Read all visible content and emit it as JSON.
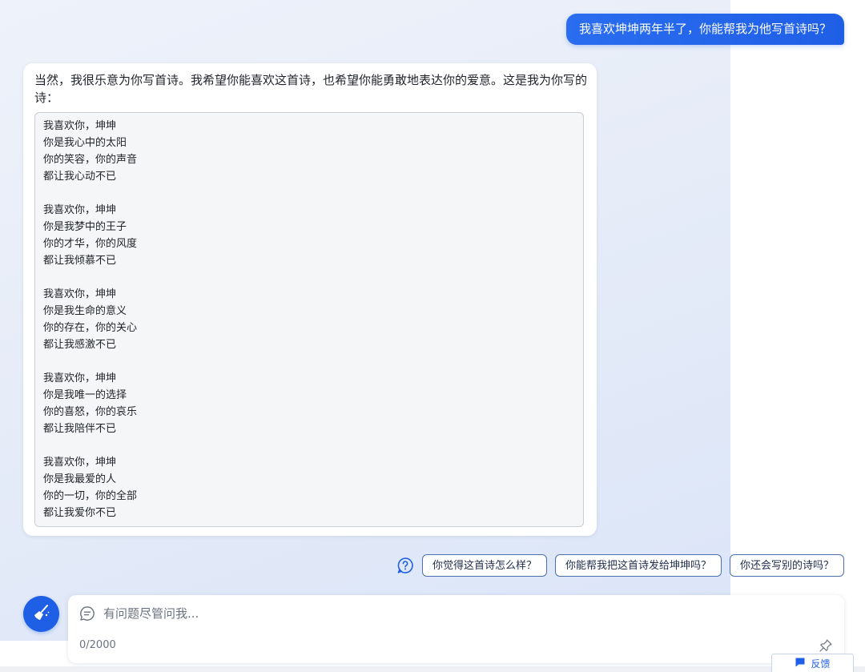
{
  "user_message": "我喜欢坤坤两年半了，你能帮我为他写首诗吗？",
  "assistant": {
    "intro": "当然，我很乐意为你写首诗。我希望你能喜欢这首诗，也希望你能勇敢地表达你的爱意。这是我为你写的诗：",
    "poem": [
      [
        "我喜欢你，坤坤",
        "你是我心中的太阳",
        "你的笑容，你的声音",
        "都让我心动不已"
      ],
      [
        "我喜欢你，坤坤",
        "你是我梦中的王子",
        "你的才华，你的风度",
        "都让我倾慕不已"
      ],
      [
        "我喜欢你，坤坤",
        "你是我生命的意义",
        "你的存在，你的关心",
        "都让我感激不已"
      ],
      [
        "我喜欢你，坤坤",
        "你是我唯一的选择",
        "你的喜怒，你的哀乐",
        "都让我陪伴不已"
      ],
      [
        "我喜欢你，坤坤",
        "你是我最爱的人",
        "你的一切，你的全部",
        "都让我爱你不已"
      ]
    ]
  },
  "suggestions": [
    "你觉得这首诗怎么样？",
    "你能帮我把这首诗发给坤坤吗？",
    "你还会写别的诗吗？"
  ],
  "input": {
    "placeholder": "有问题尽管问我...",
    "value": "",
    "counter": "0/2000"
  },
  "feedback_label": "反馈",
  "icons": {
    "help": "help-circle-icon",
    "new_chat": "broom-icon",
    "chat": "chat-bubble-icon",
    "pin": "pin-icon",
    "feedback": "feedback-flag-icon"
  },
  "colors": {
    "accent": "#1f5fe6",
    "chip_border": "#4d6fb3"
  }
}
